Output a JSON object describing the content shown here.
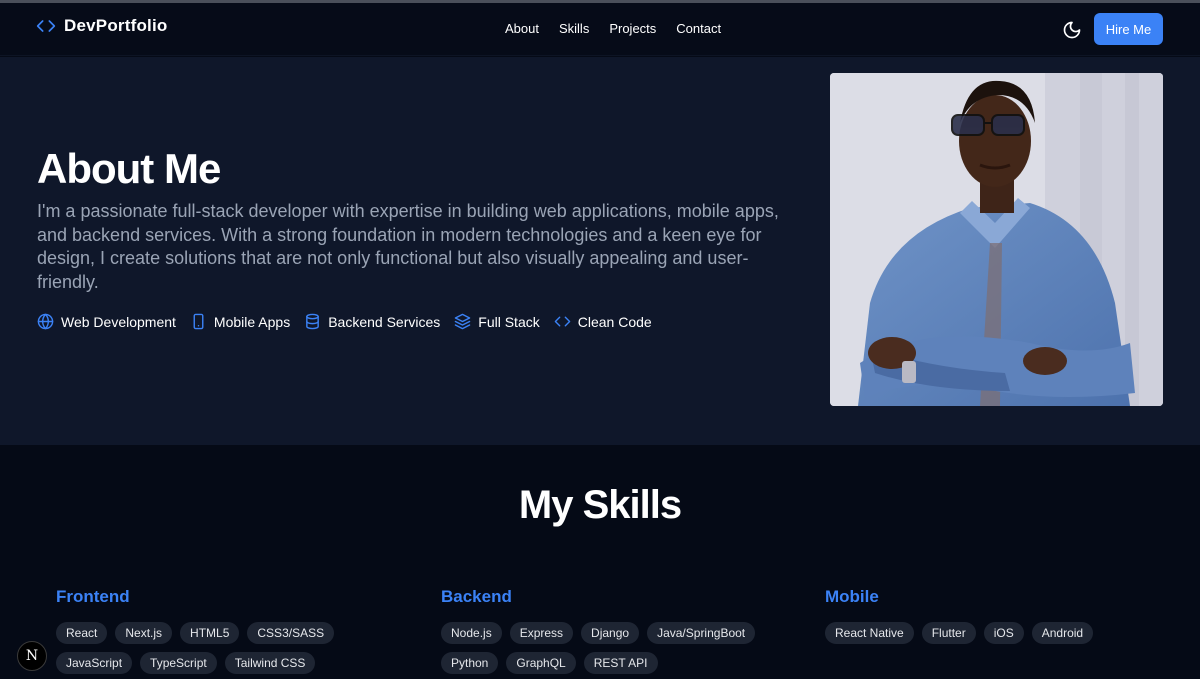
{
  "nav": {
    "brand": "DevPortfolio",
    "links": [
      {
        "label": "About"
      },
      {
        "label": "Skills"
      },
      {
        "label": "Projects"
      },
      {
        "label": "Contact"
      }
    ],
    "theme_icon": "moon-icon",
    "hire_button": "Hire Me"
  },
  "about": {
    "title": "About Me",
    "text": "I'm a passionate full-stack developer with expertise in building web applications, mobile apps, and backend services. With a strong foundation in modern technologies and a keen eye for design, I create solutions that are not only functional but also visually appealing and user-friendly.",
    "tags": [
      {
        "icon": "globe-icon",
        "label": "Web Development"
      },
      {
        "icon": "smartphone-icon",
        "label": "Mobile Apps"
      },
      {
        "icon": "database-icon",
        "label": "Backend Services"
      },
      {
        "icon": "layers-icon",
        "label": "Full Stack"
      },
      {
        "icon": "code-icon",
        "label": "Clean Code"
      }
    ]
  },
  "skills": {
    "title": "My Skills",
    "columns": [
      {
        "heading": "Frontend",
        "items": [
          "React",
          "Next.js",
          "HTML5",
          "CSS3/SASS",
          "JavaScript",
          "TypeScript",
          "Tailwind CSS"
        ]
      },
      {
        "heading": "Backend",
        "items": [
          "Node.js",
          "Express",
          "Django",
          "Java/SpringBoot",
          "Python",
          "GraphQL",
          "REST API"
        ]
      },
      {
        "heading": "Mobile",
        "items": [
          "React Native",
          "Flutter",
          "iOS",
          "Android"
        ]
      }
    ]
  },
  "dev_badge": "N",
  "colors": {
    "accent": "#3b82f6",
    "page_bg": "#050a16",
    "about_bg": "#0f172a",
    "chip_bg": "#1e2533"
  }
}
